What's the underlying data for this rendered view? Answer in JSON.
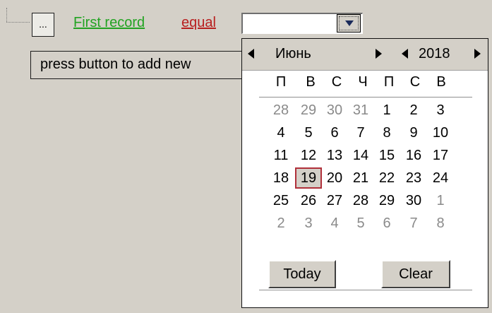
{
  "filter": {
    "ellipsis_button": "...",
    "field_link": "First record",
    "operator_link": "equal",
    "field_color": "#22a322",
    "operator_color": "#b81f1f",
    "date_value": ""
  },
  "add_new_text": "press button to add new",
  "calendar": {
    "month": "Июнь",
    "year": "2018",
    "weekdays": [
      "П",
      "В",
      "С",
      "Ч",
      "П",
      "С",
      "В"
    ],
    "weeks": [
      [
        "28",
        "29",
        "30",
        "31",
        "1",
        "2",
        "3"
      ],
      [
        "4",
        "5",
        "6",
        "7",
        "8",
        "9",
        "10"
      ],
      [
        "11",
        "12",
        "13",
        "14",
        "15",
        "16",
        "17"
      ],
      [
        "18",
        "19",
        "20",
        "21",
        "22",
        "23",
        "24"
      ],
      [
        "25",
        "26",
        "27",
        "28",
        "29",
        "30",
        "1"
      ],
      [
        "2",
        "3",
        "4",
        "5",
        "6",
        "7",
        "8"
      ]
    ],
    "selected_day": "19",
    "today_button": "Today",
    "clear_button": "Clear",
    "icons": {
      "prev_month": "triangle-left-icon",
      "next_month": "triangle-right-icon",
      "prev_year": "triangle-left-icon",
      "next_year": "triangle-right-icon",
      "dropdown": "triangle-down-icon"
    }
  }
}
